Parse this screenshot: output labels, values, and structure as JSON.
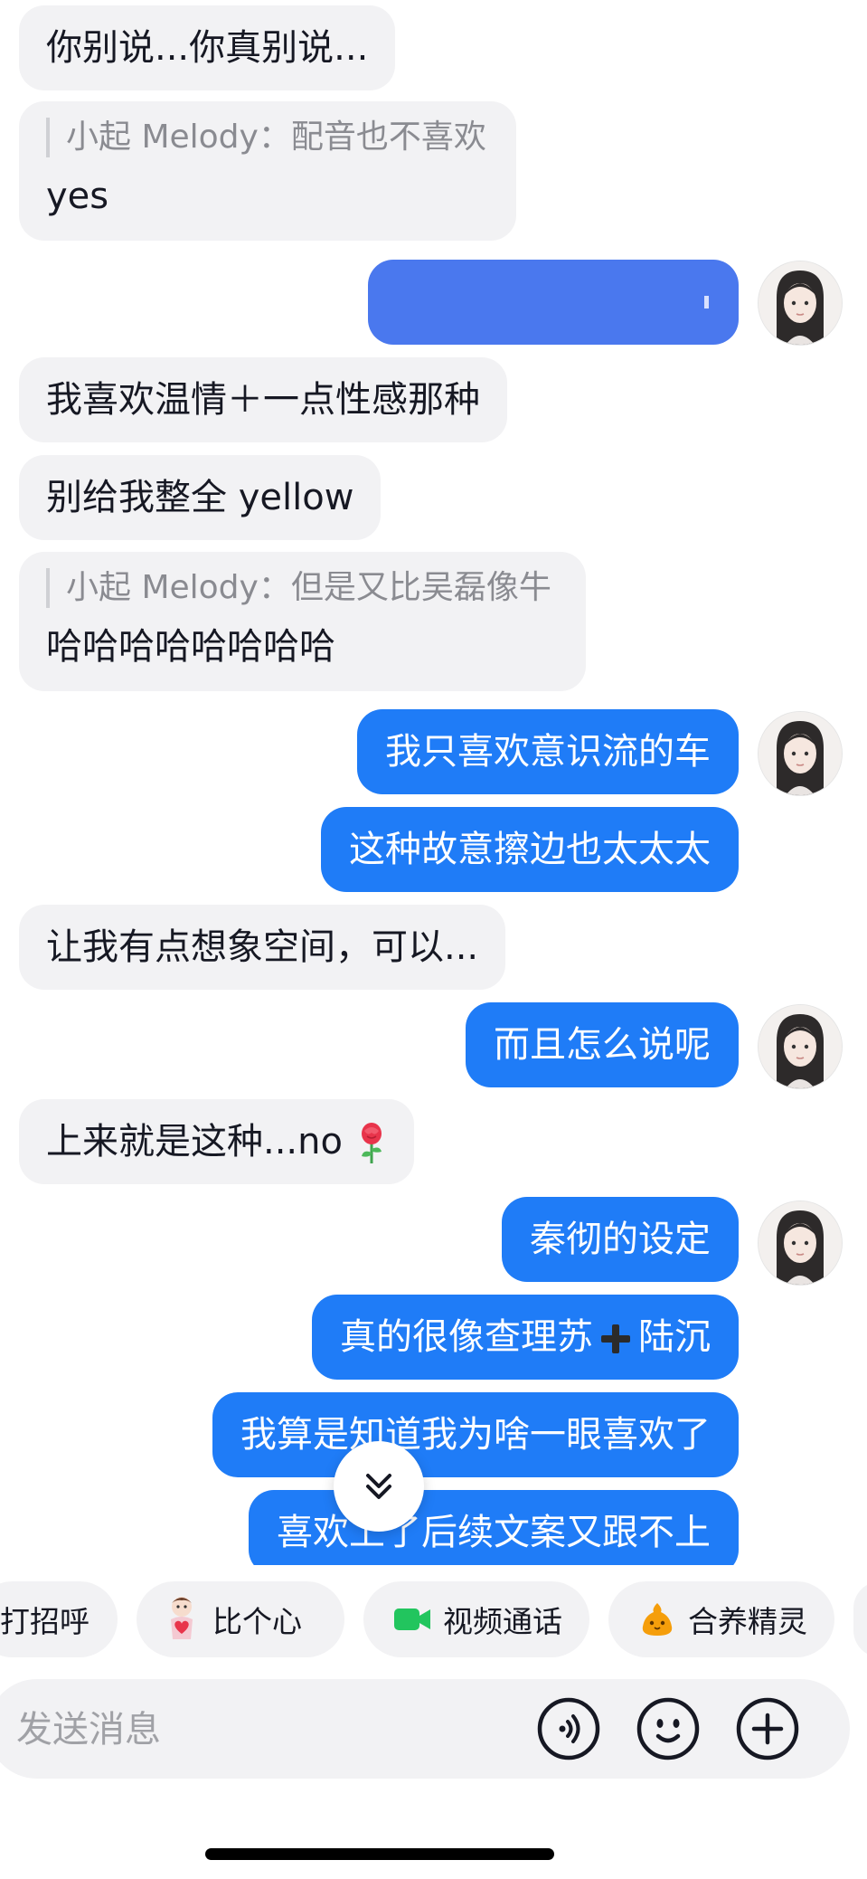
{
  "messages": [
    {
      "text": "你别说...你真别说..."
    },
    {
      "quote": "小起 Melody：配音也不喜欢",
      "text": "yes"
    },
    {
      "text": ""
    },
    {
      "text": "我喜欢温情＋一点性感那种"
    },
    {
      "text": "别给我整全 yellow"
    },
    {
      "quote": "小起 Melody：但是又比吴磊像牛",
      "text": "哈哈哈哈哈哈哈哈"
    },
    {
      "text": "我只喜欢意识流的车"
    },
    {
      "text": "这种故意擦边也太太太"
    },
    {
      "text": "让我有点想象空间，可以..."
    },
    {
      "text": "而且怎么说呢"
    },
    {
      "text": "上来就是这种...no"
    },
    {
      "text": "秦彻的设定"
    },
    {
      "text_a": "真的很像查理苏",
      "text_b": "陆沉"
    },
    {
      "text": "我算是知道我为啥一眼喜欢了"
    },
    {
      "text": "喜欢上了后续文案又跟不上"
    }
  ],
  "quick_actions": [
    {
      "label": "打招呼"
    },
    {
      "label": "比个心"
    },
    {
      "label": "视频通话"
    },
    {
      "label": "合养精灵"
    }
  ],
  "composer": {
    "placeholder": "发送消息"
  },
  "colors": {
    "outgoing_bubble": "#1f7cf7",
    "incoming_bubble": "#f2f2f4",
    "video_icon": "#22c55e",
    "sprite_icon": "#f59e0b"
  }
}
